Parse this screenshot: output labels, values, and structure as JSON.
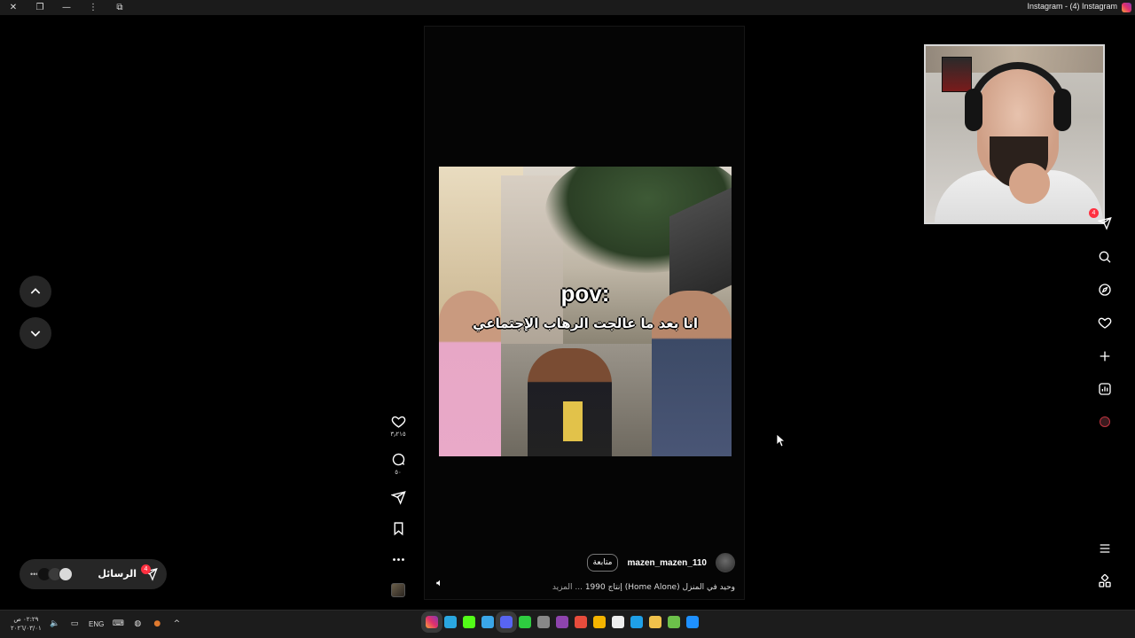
{
  "window": {
    "title": "Instagram - (4) Instagram",
    "controls": [
      "close-icon",
      "restore-icon",
      "minimize-icon",
      "more-icon",
      "extension-icon"
    ]
  },
  "reel": {
    "caption_en": "pov:",
    "caption_ar": "انا بعد ما عالجت الرهاب الإجتماعي",
    "author": "mazen_mazen_110",
    "follow_label": "متابعة",
    "description": "وحيد في المنزل (Home Alone) إنتاج 1990",
    "more_label": "... المزيد"
  },
  "actions": {
    "likes": "٣٫٢١٥",
    "comments": "٥٠"
  },
  "sidebar": {
    "notification_count": "4",
    "icons": [
      "instagram-icon",
      "reels-icon",
      "video-icon",
      "messages-icon",
      "search-icon",
      "explore-icon",
      "heart-icon",
      "create-icon",
      "dashboard-icon",
      "profile-icon",
      "menu-icon",
      "more-apps-icon"
    ]
  },
  "messages": {
    "label": "الرسائل",
    "badge": "4"
  },
  "taskbar": {
    "time": "٠٢:٢٩ ص",
    "date": "٢٠٢٦/٠٣/٠١",
    "lang": "ENG"
  },
  "colors": {
    "background": "#000000",
    "badge": "#ff3040",
    "accent_gradient": [
      "#f9a23a",
      "#e1306c",
      "#833ab4"
    ]
  }
}
